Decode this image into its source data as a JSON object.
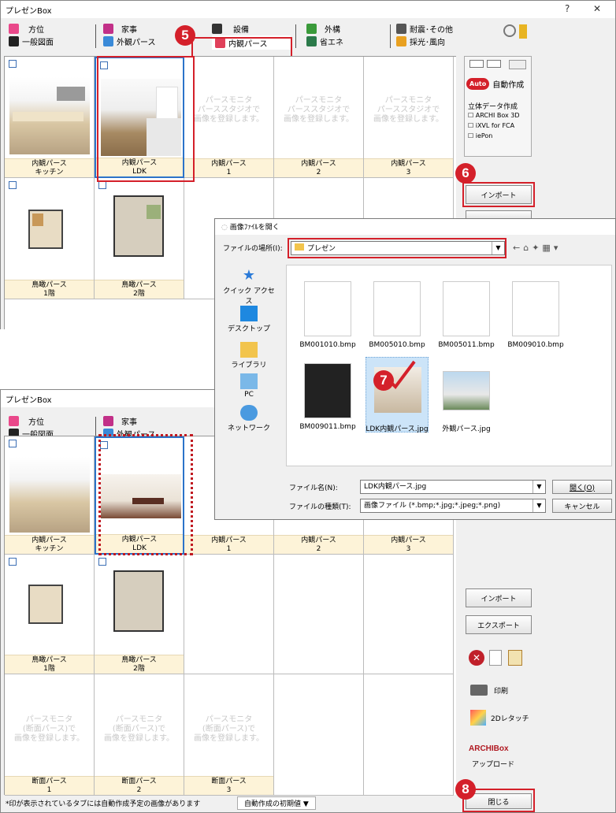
{
  "window_title": "プレゼンBox",
  "tabs": {
    "houi": "方位",
    "kaji": "家事",
    "setsubi": "設備",
    "gaikou": "外構",
    "taishin": "耐震･その他",
    "ippan": "一般図面",
    "gaikan": "外観パース",
    "naikan": "内観パース",
    "shouene": "省エネ",
    "saikou": "採光･風向"
  },
  "cells": {
    "c1": "内観パース\nキッチン",
    "c2": "内観パース\nLDK",
    "c3": "内観パース\n1",
    "c4": "内観パース\n2",
    "c5": "内観パース\n3",
    "b1": "鳥瞰パース\n1階",
    "b2": "鳥瞰パース\n2階",
    "d1": "断面パース\n1",
    "d2": "断面パース\n2",
    "d3": "断面パース\n3"
  },
  "placeholder_parse": "パースモニタ\nパーススタジオで\n画像を登録します。",
  "placeholder_section": "パースモニタ\n(断面パース)で\n画像を登録します。",
  "side": {
    "auto": "自動作成",
    "rittai": "立体データ作成",
    "archi3d": "ARCHI Box 3D",
    "ixvl": "iXVL for FCA",
    "iepon": "iePon",
    "import": "インポート",
    "export": "エクスポート",
    "print": "印刷",
    "touch": "2Dレタッチ",
    "archibox": "ARCHIBox",
    "upload": "アップロード",
    "close": "閉じる",
    "auto_badge": "Auto"
  },
  "status": {
    "note": "*印が表示されているタブには自動作成予定の画像があります",
    "auto_init": "自動作成の初期値 ▼"
  },
  "dialog": {
    "title": "画像ﾌｧｲﾙを開く",
    "location_label": "ファイルの場所(I):",
    "location_value": "プレゼン",
    "nav": [
      "クイック アクセス",
      "デスクトップ",
      "ライブラリ",
      "PC",
      "ネットワーク"
    ],
    "files": [
      "BM001010.bmp",
      "BM005010.bmp",
      "BM005011.bmp",
      "BM009010.bmp",
      "BM009011.bmp",
      "LDK内観パース.jpg",
      "外観パース.jpg"
    ],
    "filename_label": "ファイル名(N):",
    "filename_value": "LDK内観パース.jpg",
    "filetype_label": "ファイルの種類(T):",
    "filetype_value": "画像ファイル (*.bmp;*.jpg;*.jpeg;*.png)",
    "open": "開く(O)",
    "cancel": "キャンセル"
  },
  "steps": [
    "5",
    "6",
    "7",
    "8"
  ],
  "colors": {
    "accent_red": "#d4202a",
    "select_blue": "#2b73c9"
  }
}
